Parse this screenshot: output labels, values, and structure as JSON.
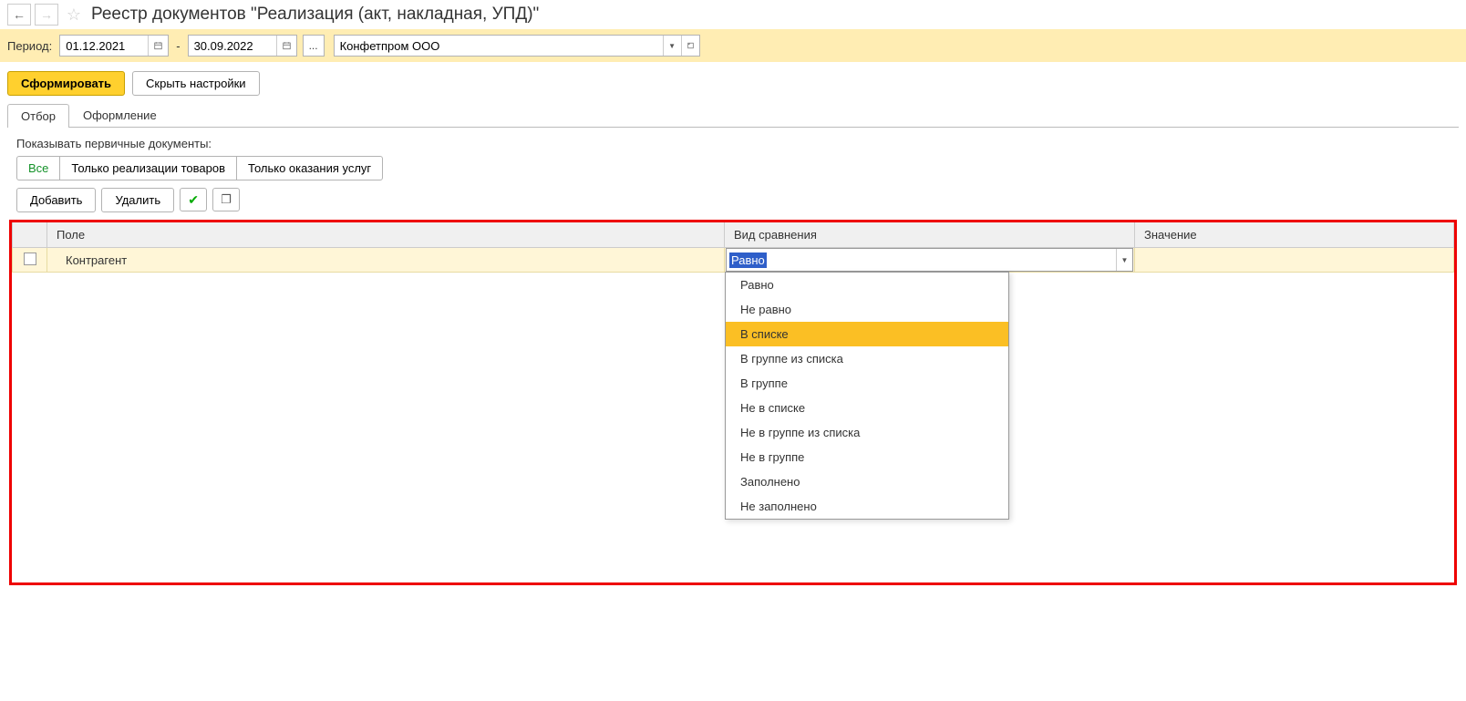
{
  "header": {
    "title": "Реестр документов \"Реализация (акт, накладная, УПД)\""
  },
  "period": {
    "label": "Период:",
    "from": "01.12.2021",
    "to": "30.09.2022",
    "dash": "-",
    "ellipsis": "...",
    "organization": "Конфетпром ООО"
  },
  "actions": {
    "generate": "Сформировать",
    "hide_settings": "Скрыть настройки"
  },
  "tabs": {
    "filter": "Отбор",
    "design": "Оформление"
  },
  "primary_docs": {
    "label": "Показывать первичные документы:",
    "segments": {
      "all": "Все",
      "goods": "Только реализации товаров",
      "services": "Только оказания услуг"
    }
  },
  "filter_actions": {
    "add": "Добавить",
    "delete": "Удалить"
  },
  "table": {
    "headers": {
      "field": "Поле",
      "comparison": "Вид сравнения",
      "value": "Значение"
    },
    "row": {
      "field": "Контрагент",
      "comparison_selected": "Равно"
    }
  },
  "dropdown": {
    "items": [
      "Равно",
      "Не равно",
      "В списке",
      "В группе из списка",
      "В группе",
      "Не в списке",
      "Не в группе из списка",
      "Не в группе",
      "Заполнено",
      "Не заполнено"
    ],
    "hover_index": 2
  }
}
